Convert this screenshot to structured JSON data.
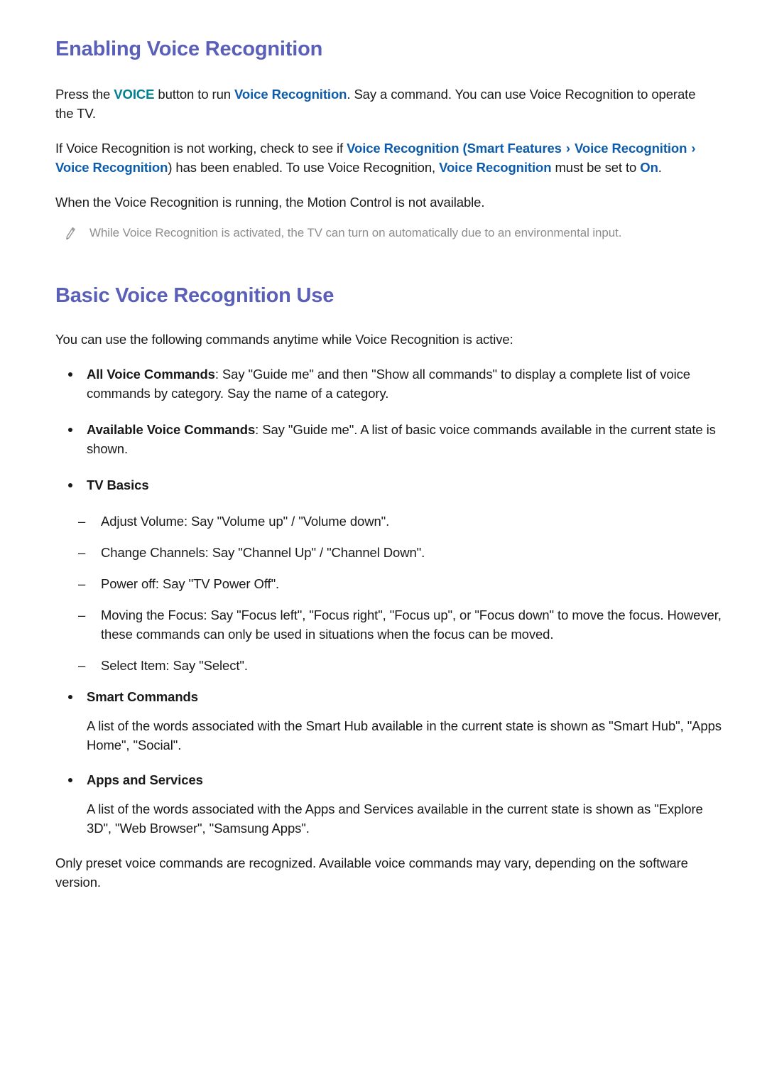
{
  "colors": {
    "heading": "#5a5fb8",
    "link": "#0d5cab",
    "voice_keyword": "#00808f",
    "body": "#191919",
    "note": "#8d8d8d"
  },
  "sections": [
    {
      "title": "Enabling Voice Recognition",
      "paragraph_1": {
        "part_1": "Press the ",
        "voice_button": "VOICE",
        "part_2": " button to run ",
        "link_1": "Voice Recognition",
        "part_3": ". Say a command. You can use Voice Recognition to operate the TV."
      },
      "paragraph_2": {
        "part_1": "If Voice Recognition is not working, check to see if ",
        "link_1": "Voice Recognition",
        "open_paren": "(",
        "link_2": "Smart Features",
        "chevron_1": "›",
        "link_3": "Voice Recognition",
        "chevron_2": "›",
        "link_4": "Voice Recognition",
        "close_paren": ")",
        "part_2": " has been enabled. To use Voice Recognition, ",
        "link_5": "Voice Recognition",
        "part_3": " must be set to ",
        "link_6": "On",
        "part_4": "."
      },
      "paragraph_3": "When the Voice Recognition is running, the Motion Control is not available.",
      "note": {
        "icon": "pencil-icon",
        "text": "While Voice Recognition is activated, the TV can turn on automatically due to an environmental input."
      }
    },
    {
      "title": "Basic Voice Recognition Use",
      "intro": "You can use the following commands anytime while Voice Recognition is active:",
      "bullets": [
        {
          "term": "All Voice Commands",
          "rest": ": Say \"Guide me\" and then \"Show all commands\" to display a complete list of voice commands by category. Say the name of a category."
        },
        {
          "term": "Available Voice Commands",
          "rest": ": Say \"Guide me\". A list of basic voice commands available in the current state is shown."
        },
        {
          "term": "TV Basics",
          "rest": ""
        }
      ],
      "tv_basics_items": [
        "Adjust Volume: Say \"Volume up\" / \"Volume down\".",
        "Change Channels: Say \"Channel Up\" / \"Channel Down\".",
        "Power off: Say \"TV Power Off\".",
        "Moving the Focus: Say \"Focus left\", \"Focus right\", \"Focus up\", or \"Focus down\" to move the focus. However, these commands can only be used in situations when the focus can be moved.",
        "Select Item: Say \"Select\"."
      ],
      "smart_commands": {
        "term": "Smart Commands",
        "body": "A list of the words associated with the Smart Hub available in the current state is shown as \"Smart Hub\", \"Apps Home\", \"Social\"."
      },
      "apps_and_services": {
        "term": "Apps and Services",
        "body": "A list of the words associated with the Apps and Services available in the current state is shown as \"Explore 3D\", \"Web Browser\", \"Samsung Apps\"."
      },
      "closing": "Only preset voice commands are recognized. Available voice commands may vary, depending on the software version."
    }
  ]
}
